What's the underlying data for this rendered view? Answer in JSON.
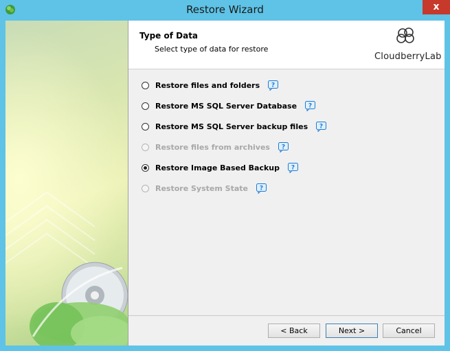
{
  "window": {
    "title": "Restore Wizard",
    "close_label": "x"
  },
  "header": {
    "title": "Type of Data",
    "subtitle": "Select type of data for restore",
    "logo_text": "CloudberryLab",
    "logo_icon": "cloudberry-logo-icon"
  },
  "options": [
    {
      "label": "Restore files and folders",
      "checked": false,
      "enabled": true
    },
    {
      "label": "Restore MS SQL Server Database",
      "checked": false,
      "enabled": true
    },
    {
      "label": "Restore MS SQL Server backup files",
      "checked": false,
      "enabled": true
    },
    {
      "label": "Restore files from archives",
      "checked": false,
      "enabled": false
    },
    {
      "label": "Restore Image Based Backup",
      "checked": true,
      "enabled": true
    },
    {
      "label": "Restore System State",
      "checked": false,
      "enabled": false
    }
  ],
  "buttons": {
    "back": "< Back",
    "next": "Next >",
    "cancel": "Cancel"
  },
  "colors": {
    "titlebar": "#5ec3e6",
    "close": "#c7392b",
    "help": "#1e7bd0"
  }
}
